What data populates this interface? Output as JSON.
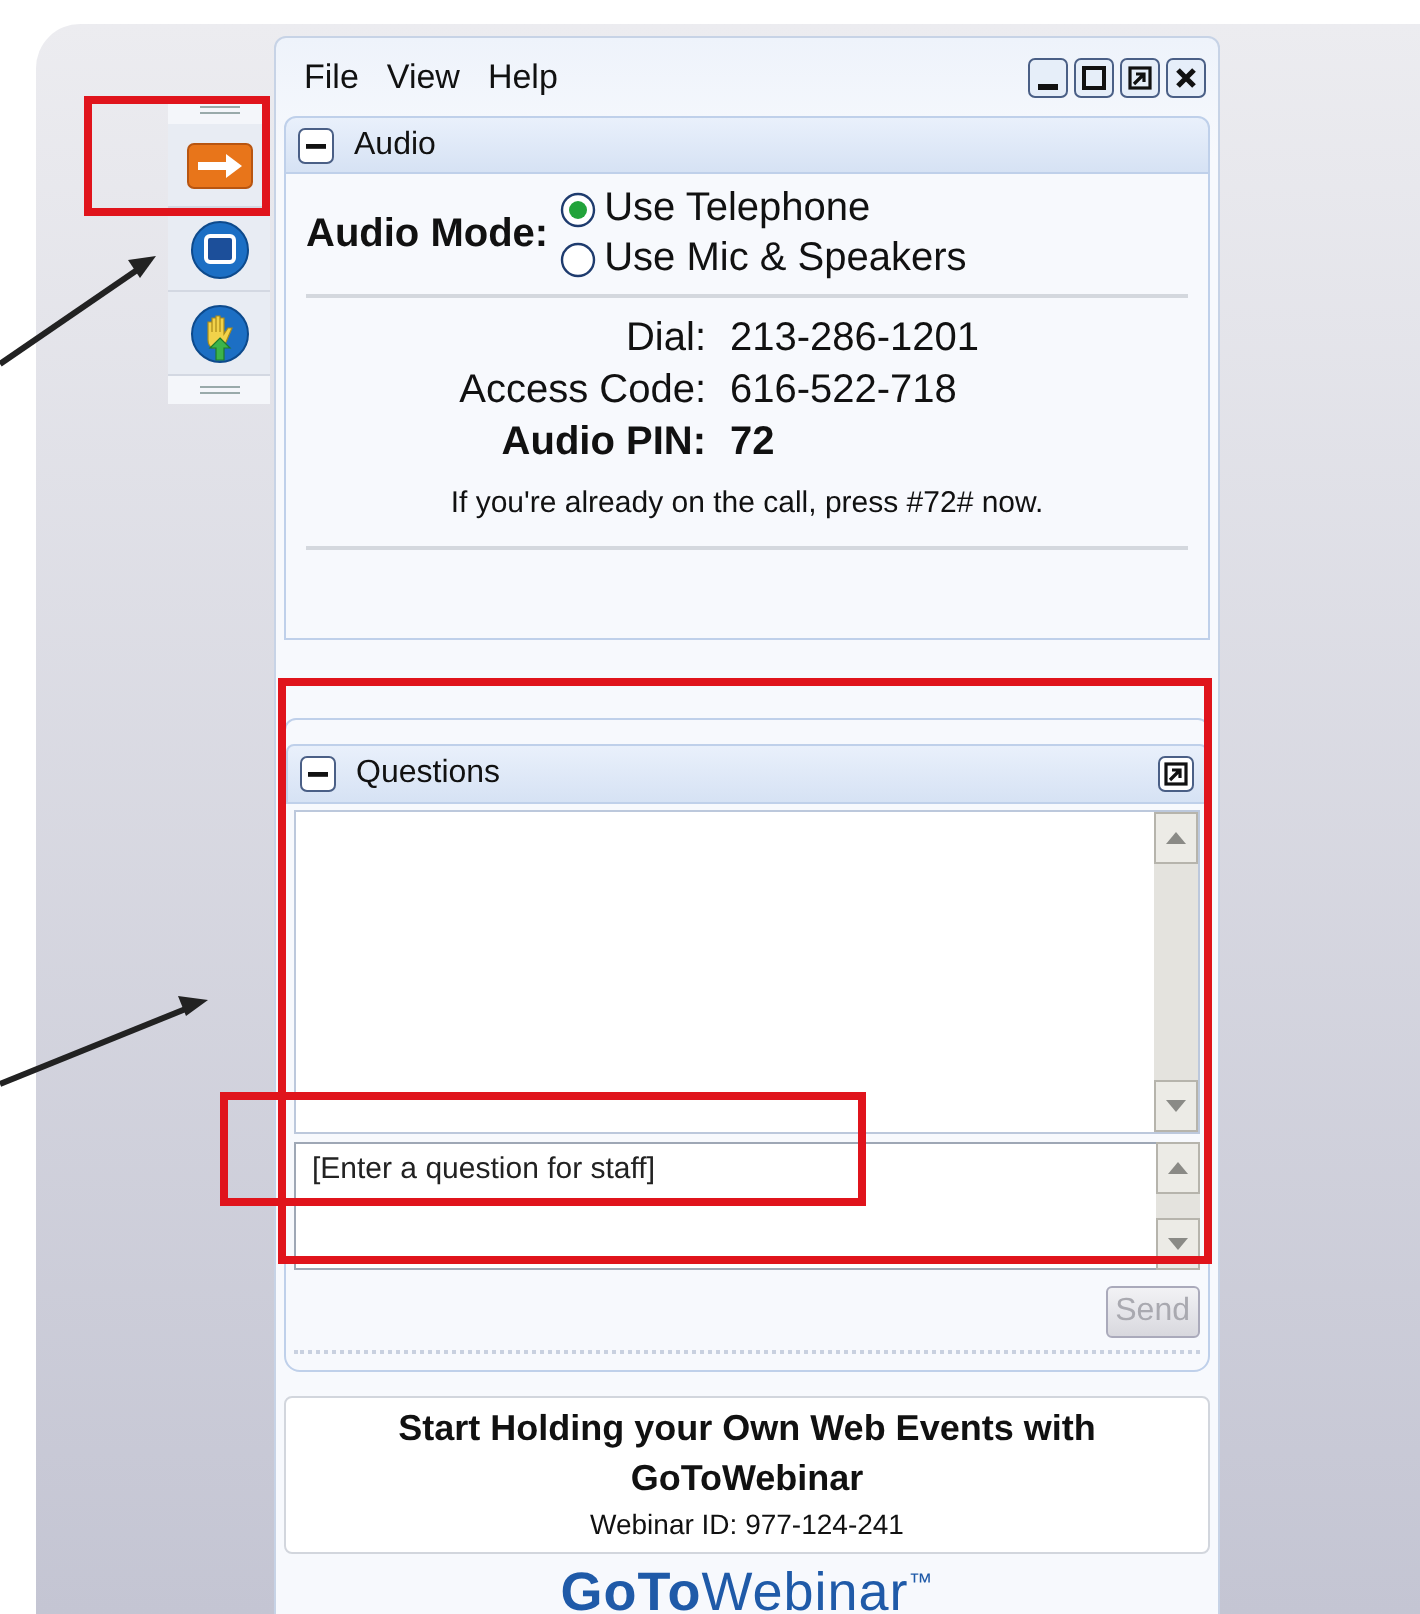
{
  "menu": [
    "File",
    "View",
    "Help"
  ],
  "toolbar": [
    {
      "kind": "arrow"
    },
    {
      "kind": "screen"
    },
    {
      "kind": "hand"
    }
  ],
  "audio": {
    "title": "Audio",
    "expanded": true,
    "mode_label": "Audio Mode:",
    "options": [
      {
        "label": "Use Telephone",
        "selected": true
      },
      {
        "label": "Use Mic & Speakers",
        "selected": false
      }
    ],
    "details": [
      {
        "label": "Dial:",
        "value": "213-286-1201",
        "emphasis": false
      },
      {
        "label": "Access Code:",
        "value": "616-522-718",
        "emphasis": false
      },
      {
        "label": "Audio PIN:",
        "value": "72",
        "emphasis": true
      }
    ],
    "note": "If you're already on the call, press #72# now."
  },
  "questions": {
    "title": "Questions",
    "expanded": true,
    "placeholder": "[Enter a question for staff]",
    "send": "Send",
    "send_disabled": true
  },
  "promo": {
    "headline": "Start Holding your Own Web Events with GoToWebinar",
    "webinar_id": "Webinar ID: 977-124-241"
  },
  "logo": "**GoTo**Webinar$^{™}$"
}
